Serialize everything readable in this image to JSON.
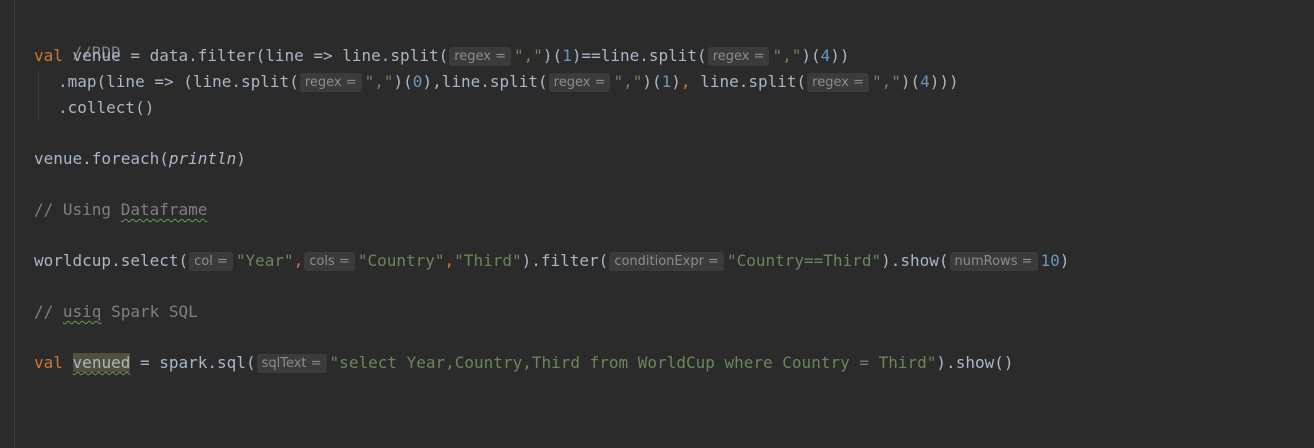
{
  "code": {
    "l1": {
      "comment": "//RDD"
    },
    "l2": {
      "kw": "val",
      "a": " venue = data.filter(line => line.split(",
      "hint1": "regex =",
      "s1": "\",\"",
      "b": ")(",
      "n1": "1",
      "c": ")==line.split(",
      "hint2": "regex =",
      "s2": "\",\"",
      "d": ")(",
      "n2": "4",
      "e": "))"
    },
    "l3": {
      "a": ".map(line => (line.split(",
      "hint1": "regex =",
      "s1": "\",\"",
      "b": ")(",
      "n1": "0",
      "c": "),line.split(",
      "hint2": "regex =",
      "s2": "\",\"",
      "d": ")(",
      "n2": "1",
      "e": ")",
      "comma": ",",
      "f": " line.split(",
      "hint3": "regex =",
      "s3": "\",\"",
      "g": ")(",
      "n3": "4",
      "h": ")))"
    },
    "l4": {
      "a": ".collect()"
    },
    "l5": {
      "a": "venue.foreach(",
      "fn": "println",
      "b": ")"
    },
    "l6": {
      "a": "// Using ",
      "word": "Dataframe"
    },
    "l7": {
      "a": "worldcup.select(",
      "hint1": "col =",
      "s1": "\"Year\"",
      "comma": ",",
      "hint2": "cols =",
      "s2": "\"Country\"",
      "comma2": ",",
      "s3": "\"Third\"",
      "b": ").filter(",
      "hint3": "conditionExpr =",
      "s4": "\"Country==Third\"",
      "c": ").show(",
      "hint4": "numRows =",
      "n1": "10",
      "d": ")"
    },
    "l8": {
      "a": "// ",
      "word": "usiq",
      "b": " Spark SQL"
    },
    "l9": {
      "kw": "val",
      "var": "venued",
      "a": " = spark.sql(",
      "hint1": "sqlText =",
      "s1": "\"select Year,Country,Third from WorldCup where Country = Third\"",
      "b": ").show()"
    }
  },
  "colors": {
    "background": "#2b2b2b",
    "keyword": "#cc7832",
    "string": "#6a8759",
    "number": "#6897bb",
    "comment": "#808080",
    "text": "#a9b7c6"
  }
}
